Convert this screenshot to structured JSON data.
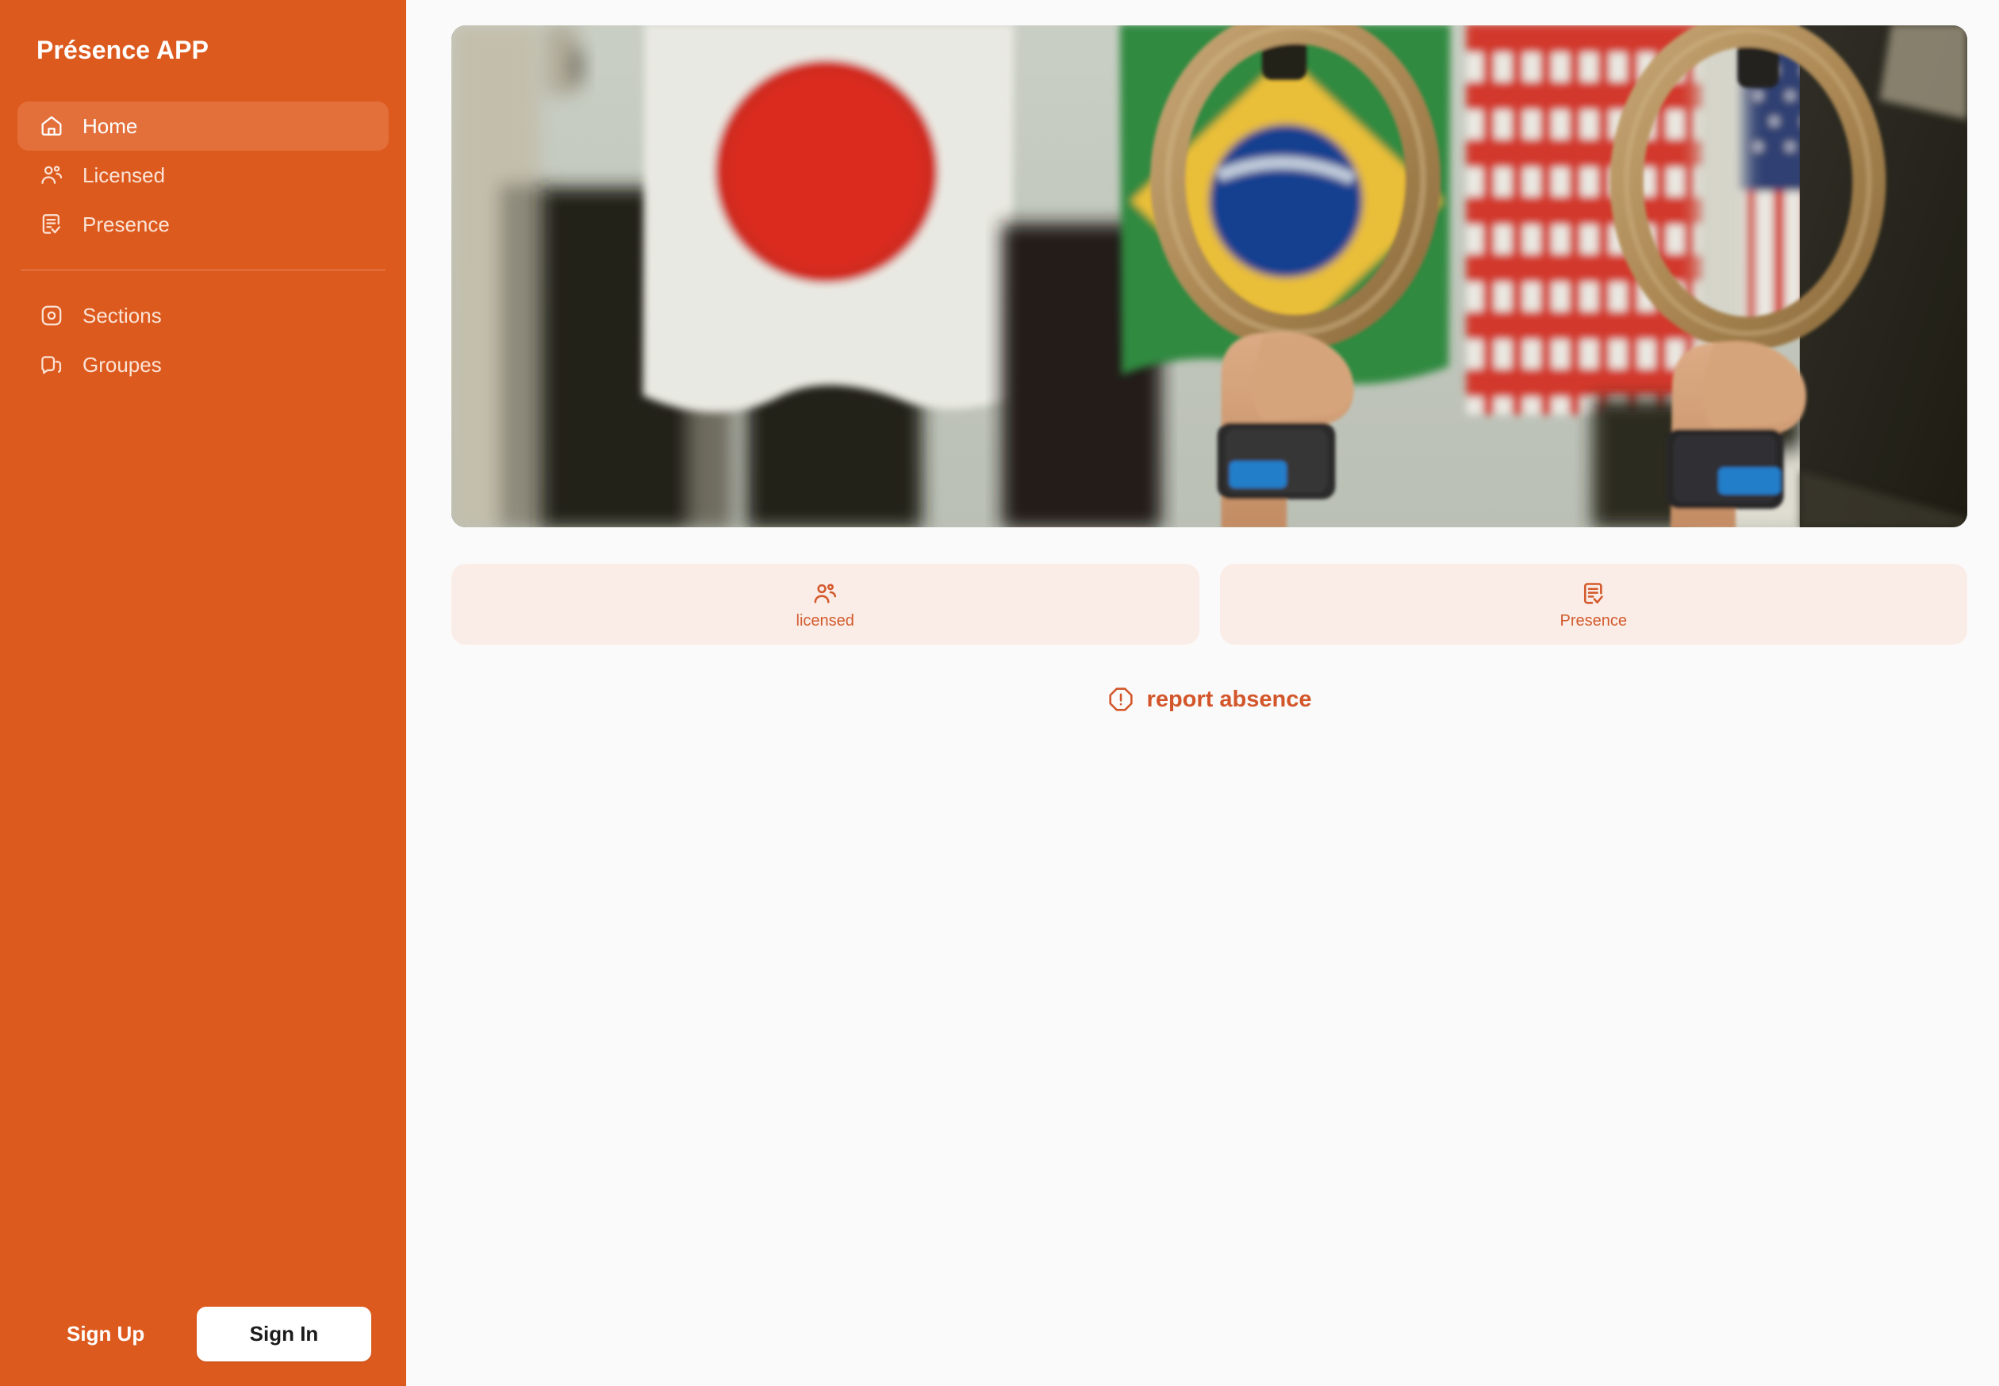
{
  "app": {
    "brand": "Présence APP"
  },
  "colors": {
    "sidebar_bg": "#DD5A1E",
    "sidebar_active_bg": "#E3703B",
    "main_bg": "#FAFAFA",
    "card_bg": "#FAEDE7",
    "accent": "#D3562A",
    "button_bg": "#FFFFFF",
    "button_text": "#1B1B1B"
  },
  "sidebar": {
    "primary_items": [
      {
        "label": "Home",
        "icon": "home-icon",
        "active": true
      },
      {
        "label": "Licensed",
        "icon": "users-icon",
        "active": false
      },
      {
        "label": "Presence",
        "icon": "document-check-icon",
        "active": false
      }
    ],
    "secondary_items": [
      {
        "label": "Sections",
        "icon": "aperture-icon",
        "active": false
      },
      {
        "label": "Groupes",
        "icon": "chat-bubbles-icon",
        "active": false
      }
    ],
    "footer": {
      "sign_up_label": "Sign Up",
      "sign_in_label": "Sign In"
    }
  },
  "main": {
    "hero": {
      "alt": "Athlete hands gripping wooden gymnastic rings in a gym with Japan, Brazil and USA flags hanging in the background"
    },
    "action_cards": [
      {
        "label": "licensed",
        "icon": "users-icon"
      },
      {
        "label": "Presence",
        "icon": "document-check-icon"
      }
    ],
    "report_absence": {
      "label": "report absence",
      "icon": "alert-octagon-icon"
    }
  }
}
